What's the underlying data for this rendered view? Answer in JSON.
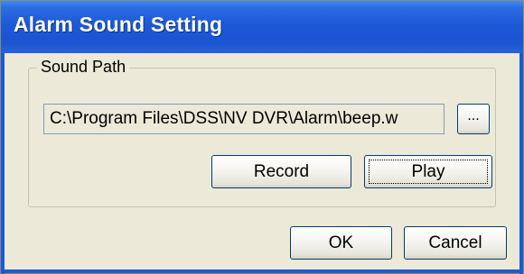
{
  "window": {
    "title": "Alarm Sound Setting"
  },
  "sound_path": {
    "group_label": "Sound Path",
    "path_value": "C:\\Program Files\\DSS\\NV DVR\\Alarm\\beep.w",
    "browse_label": "..."
  },
  "buttons": {
    "record": "Record",
    "play": "Play",
    "ok": "OK",
    "cancel": "Cancel"
  },
  "colors": {
    "titlebar": "#1c59d6",
    "dialog_bg": "#ece9d8"
  }
}
